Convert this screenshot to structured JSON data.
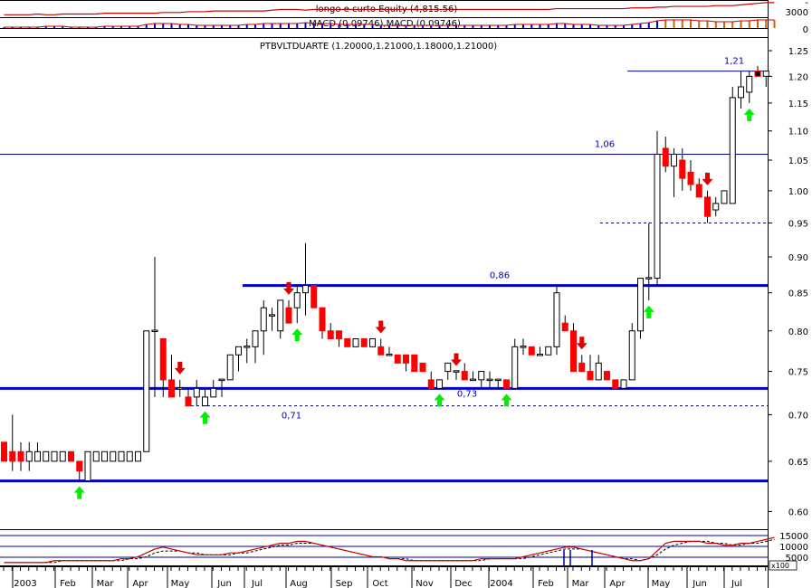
{
  "colors": {
    "up": "#ffffff",
    "down": "#ff0000",
    "black": "#000000",
    "level": "#0000cc",
    "thin_level": "#000099",
    "arrow_up": "#00ee00",
    "arrow_down": "#e00000",
    "equity": "#cc0000",
    "macd": "#cc0000",
    "signal": "#000000"
  },
  "equity_panel": {
    "title": "longo e curto Equity (4,815.56)",
    "ticks": [
      "3000"
    ]
  },
  "macd_panel": {
    "title": "MACD (0.09746),MACD (0.09746)",
    "ticks": [
      "0"
    ]
  },
  "volume_panel": {
    "ticks": [
      "15000",
      "10000",
      "5000"
    ],
    "scale_label": "x100"
  },
  "chart_data": {
    "type": "candlestick",
    "title": "PTBVLTDUARTE (1.20000,1.21000,1.18000,1.21000)",
    "y_ticks": [
      "1.25",
      "1.20",
      "1.15",
      "1.10",
      "1.05",
      "1.00",
      "0.95",
      "0.90",
      "0.85",
      "0.80",
      "0.75",
      "0.70",
      "0.65",
      "0.60"
    ],
    "x_ticks": [
      "2003",
      "Feb",
      "Mar",
      "Apr",
      "May",
      "Jun",
      "Jul",
      "Aug",
      "Sep",
      "Oct",
      "Nov",
      "Dec",
      "2004",
      "Feb",
      "Mar",
      "Apr",
      "May",
      "Jun",
      "Jul"
    ],
    "ylim": [
      0.585,
      1.27
    ],
    "levels": [
      {
        "value": 1.21,
        "label": "1,21",
        "style": "thin"
      },
      {
        "value": 1.06,
        "label": "1,06",
        "style": "thin"
      },
      {
        "value": 0.95,
        "label": "",
        "style": "dashed"
      },
      {
        "value": 0.86,
        "label": "0,86",
        "style": "thick"
      },
      {
        "value": 0.73,
        "label": "0,73",
        "style": "thick"
      },
      {
        "value": 0.71,
        "label": "0,71",
        "style": "dashed"
      },
      {
        "value": 0.63,
        "label": "",
        "style": "thick"
      }
    ],
    "candles": [
      [
        0.67,
        0.67,
        0.65,
        0.65
      ],
      [
        0.66,
        0.7,
        0.64,
        0.65
      ],
      [
        0.66,
        0.67,
        0.64,
        0.65
      ],
      [
        0.65,
        0.67,
        0.64,
        0.66
      ],
      [
        0.65,
        0.67,
        0.65,
        0.66
      ],
      [
        0.65,
        0.66,
        0.65,
        0.66
      ],
      [
        0.65,
        0.66,
        0.65,
        0.66
      ],
      [
        0.65,
        0.66,
        0.65,
        0.66
      ],
      [
        0.66,
        0.66,
        0.65,
        0.65
      ],
      [
        0.65,
        0.65,
        0.63,
        0.64
      ],
      [
        0.63,
        0.66,
        0.63,
        0.66
      ],
      [
        0.65,
        0.66,
        0.65,
        0.66
      ],
      [
        0.65,
        0.66,
        0.65,
        0.66
      ],
      [
        0.65,
        0.66,
        0.65,
        0.66
      ],
      [
        0.65,
        0.66,
        0.65,
        0.66
      ],
      [
        0.65,
        0.66,
        0.65,
        0.66
      ],
      [
        0.65,
        0.66,
        0.65,
        0.66
      ],
      [
        0.66,
        0.8,
        0.66,
        0.8
      ],
      [
        0.8,
        0.9,
        0.72,
        0.8
      ],
      [
        0.79,
        0.79,
        0.72,
        0.74
      ],
      [
        0.74,
        0.77,
        0.72,
        0.72
      ],
      [
        0.73,
        0.74,
        0.72,
        0.73
      ],
      [
        0.72,
        0.73,
        0.71,
        0.71
      ],
      [
        0.72,
        0.74,
        0.71,
        0.73
      ],
      [
        0.71,
        0.73,
        0.71,
        0.72
      ],
      [
        0.72,
        0.74,
        0.72,
        0.73
      ],
      [
        0.74,
        0.74,
        0.72,
        0.74
      ],
      [
        0.74,
        0.77,
        0.74,
        0.77
      ],
      [
        0.77,
        0.78,
        0.75,
        0.78
      ],
      [
        0.78,
        0.79,
        0.76,
        0.78
      ],
      [
        0.78,
        0.8,
        0.76,
        0.8
      ],
      [
        0.8,
        0.84,
        0.77,
        0.83
      ],
      [
        0.82,
        0.83,
        0.8,
        0.82
      ],
      [
        0.8,
        0.84,
        0.79,
        0.84
      ],
      [
        0.83,
        0.84,
        0.81,
        0.81
      ],
      [
        0.83,
        0.86,
        0.81,
        0.85
      ],
      [
        0.85,
        0.92,
        0.82,
        0.86
      ],
      [
        0.86,
        0.86,
        0.83,
        0.83
      ],
      [
        0.83,
        0.83,
        0.79,
        0.8
      ],
      [
        0.8,
        0.81,
        0.79,
        0.79
      ],
      [
        0.8,
        0.8,
        0.78,
        0.79
      ],
      [
        0.79,
        0.79,
        0.78,
        0.78
      ],
      [
        0.78,
        0.79,
        0.78,
        0.79
      ],
      [
        0.79,
        0.79,
        0.78,
        0.78
      ],
      [
        0.78,
        0.79,
        0.78,
        0.79
      ],
      [
        0.78,
        0.79,
        0.77,
        0.77
      ],
      [
        0.77,
        0.78,
        0.77,
        0.77
      ],
      [
        0.77,
        0.77,
        0.76,
        0.76
      ],
      [
        0.77,
        0.77,
        0.75,
        0.76
      ],
      [
        0.77,
        0.77,
        0.75,
        0.75
      ],
      [
        0.76,
        0.76,
        0.75,
        0.75
      ],
      [
        0.74,
        0.75,
        0.73,
        0.73
      ],
      [
        0.73,
        0.74,
        0.73,
        0.74
      ],
      [
        0.75,
        0.76,
        0.74,
        0.76
      ],
      [
        0.75,
        0.75,
        0.74,
        0.75
      ],
      [
        0.75,
        0.76,
        0.74,
        0.74
      ],
      [
        0.74,
        0.75,
        0.74,
        0.74
      ],
      [
        0.74,
        0.75,
        0.73,
        0.75
      ],
      [
        0.74,
        0.75,
        0.73,
        0.74
      ],
      [
        0.74,
        0.74,
        0.73,
        0.74
      ],
      [
        0.74,
        0.74,
        0.73,
        0.73
      ],
      [
        0.73,
        0.79,
        0.73,
        0.78
      ],
      [
        0.78,
        0.79,
        0.77,
        0.78
      ],
      [
        0.78,
        0.78,
        0.77,
        0.77
      ],
      [
        0.77,
        0.78,
        0.77,
        0.77
      ],
      [
        0.77,
        0.78,
        0.77,
        0.78
      ],
      [
        0.78,
        0.86,
        0.77,
        0.85
      ],
      [
        0.81,
        0.82,
        0.8,
        0.8
      ],
      [
        0.8,
        0.81,
        0.75,
        0.75
      ],
      [
        0.76,
        0.77,
        0.75,
        0.75
      ],
      [
        0.75,
        0.77,
        0.74,
        0.74
      ],
      [
        0.74,
        0.77,
        0.74,
        0.76
      ],
      [
        0.75,
        0.75,
        0.74,
        0.74
      ],
      [
        0.74,
        0.74,
        0.73,
        0.73
      ],
      [
        0.73,
        0.74,
        0.73,
        0.74
      ],
      [
        0.74,
        0.81,
        0.74,
        0.8
      ],
      [
        0.8,
        0.87,
        0.79,
        0.87
      ],
      [
        0.87,
        0.95,
        0.84,
        0.87
      ],
      [
        0.87,
        1.1,
        0.86,
        1.06
      ],
      [
        1.07,
        1.09,
        1.03,
        1.04
      ],
      [
        1.04,
        1.07,
        0.99,
        1.06
      ],
      [
        1.05,
        1.07,
        1.0,
        1.02
      ],
      [
        1.03,
        1.05,
        1.0,
        1.01
      ],
      [
        1.01,
        1.02,
        0.99,
        0.99
      ],
      [
        0.99,
        1.0,
        0.95,
        0.96
      ],
      [
        0.97,
        0.99,
        0.96,
        0.98
      ],
      [
        0.98,
        1.0,
        0.98,
        1.0
      ],
      [
        0.98,
        1.18,
        0.98,
        1.16
      ],
      [
        1.16,
        1.21,
        1.14,
        1.18
      ],
      [
        1.17,
        1.21,
        1.15,
        1.2
      ],
      [
        1.21,
        1.22,
        1.2,
        1.2
      ],
      [
        1.2,
        1.21,
        1.18,
        1.21
      ]
    ],
    "signals": [
      {
        "i": 9,
        "dir": "up"
      },
      {
        "i": 21,
        "dir": "down"
      },
      {
        "i": 24,
        "dir": "up"
      },
      {
        "i": 34,
        "dir": "down"
      },
      {
        "i": 35,
        "dir": "up"
      },
      {
        "i": 45,
        "dir": "down"
      },
      {
        "i": 52,
        "dir": "up"
      },
      {
        "i": 54,
        "dir": "down"
      },
      {
        "i": 60,
        "dir": "up"
      },
      {
        "i": 69,
        "dir": "down"
      },
      {
        "i": 77,
        "dir": "up"
      },
      {
        "i": 84,
        "dir": "down"
      },
      {
        "i": 89,
        "dir": "up"
      }
    ],
    "equity": [
      20,
      20,
      20,
      20,
      21,
      20,
      20,
      21,
      21,
      21,
      21,
      21,
      22,
      22,
      22,
      22,
      22,
      22,
      22,
      23,
      23,
      23,
      24,
      24,
      24,
      25,
      25,
      25,
      25,
      25,
      25,
      25,
      26,
      27,
      27,
      27,
      26,
      27,
      27,
      27,
      27,
      27,
      27,
      27,
      27,
      27,
      27,
      27,
      27,
      27,
      27,
      27,
      27,
      27,
      27,
      27,
      27,
      27,
      27,
      27,
      27,
      27,
      27,
      27,
      27,
      27,
      28,
      28,
      28,
      28,
      28,
      28,
      28,
      28,
      28,
      29,
      29,
      29,
      30,
      30,
      31,
      31,
      31,
      31,
      31,
      32,
      32,
      32,
      33,
      34,
      35,
      36,
      36
    ],
    "macd": [
      -3,
      -3,
      -3,
      -3,
      -3,
      -2,
      -2,
      -2,
      -3,
      -3,
      -3,
      -3,
      -2,
      -2,
      -2,
      -2,
      -2,
      0,
      1,
      1,
      1,
      0,
      0,
      -1,
      -1,
      -1,
      -1,
      -1,
      -1,
      0,
      0,
      1,
      1,
      1,
      1,
      1,
      2,
      1,
      1,
      1,
      0,
      0,
      0,
      0,
      0,
      -1,
      -1,
      -1,
      -1,
      -1,
      -1,
      -1,
      -1,
      -1,
      -1,
      -1,
      -1,
      -1,
      -1,
      -1,
      -1,
      0,
      0,
      0,
      0,
      0,
      1,
      1,
      0,
      0,
      0,
      -1,
      -1,
      -1,
      -1,
      0,
      1,
      2,
      4,
      5,
      5,
      5,
      5,
      4,
      4,
      3,
      3,
      3,
      4,
      4,
      5,
      5,
      5
    ],
    "macd_signal": [
      -3,
      -3,
      -3,
      -3,
      -3,
      -3,
      -3,
      -2,
      -2,
      -3,
      -3,
      -3,
      -3,
      -2,
      -2,
      -2,
      -2,
      -1,
      0,
      0,
      1,
      0,
      0,
      0,
      -1,
      -1,
      -1,
      -1,
      -1,
      0,
      0,
      0,
      1,
      1,
      1,
      1,
      1,
      1,
      1,
      1,
      1,
      0,
      0,
      0,
      0,
      0,
      -1,
      -1,
      -1,
      -1,
      -1,
      -1,
      -1,
      -1,
      -1,
      -1,
      -1,
      -1,
      -1,
      -1,
      -1,
      -1,
      0,
      0,
      0,
      0,
      0,
      1,
      1,
      0,
      0,
      0,
      -1,
      -1,
      -1,
      -1,
      0,
      1,
      2,
      3,
      4,
      5,
      5,
      5,
      4,
      4,
      4,
      3,
      4,
      4,
      4,
      5,
      5
    ],
    "volume_macd": [
      4,
      4,
      4,
      4,
      4,
      4,
      5,
      5,
      5,
      5,
      5,
      5,
      5,
      5,
      6,
      6,
      7,
      9,
      11,
      12,
      11,
      10,
      9,
      8,
      8,
      8,
      8,
      9,
      9,
      10,
      11,
      12,
      13,
      14,
      14,
      15,
      15,
      14,
      13,
      12,
      11,
      10,
      9,
      8,
      7,
      7,
      6,
      6,
      5,
      5,
      5,
      5,
      5,
      5,
      5,
      5,
      5,
      6,
      6,
      6,
      6,
      6,
      7,
      8,
      9,
      10,
      11,
      12,
      12,
      11,
      10,
      9,
      8,
      7,
      6,
      5,
      5,
      6,
      10,
      14,
      15,
      15,
      15,
      15,
      14,
      14,
      13,
      13,
      14,
      14,
      15,
      16,
      17
    ],
    "volume_signal": [
      4,
      4,
      4,
      4,
      4,
      4,
      4,
      5,
      5,
      5,
      5,
      5,
      5,
      5,
      5,
      6,
      6,
      7,
      9,
      10,
      10,
      10,
      9,
      9,
      8,
      8,
      8,
      8,
      9,
      9,
      10,
      11,
      12,
      13,
      13,
      14,
      14,
      14,
      13,
      12,
      11,
      10,
      9,
      8,
      7,
      7,
      6,
      6,
      6,
      5,
      5,
      5,
      5,
      5,
      5,
      5,
      5,
      5,
      6,
      6,
      6,
      6,
      6,
      7,
      8,
      9,
      10,
      11,
      11,
      11,
      10,
      9,
      8,
      7,
      6,
      6,
      5,
      6,
      8,
      11,
      13,
      14,
      15,
      15,
      15,
      14,
      14,
      13,
      13,
      14,
      14,
      15,
      16
    ]
  }
}
